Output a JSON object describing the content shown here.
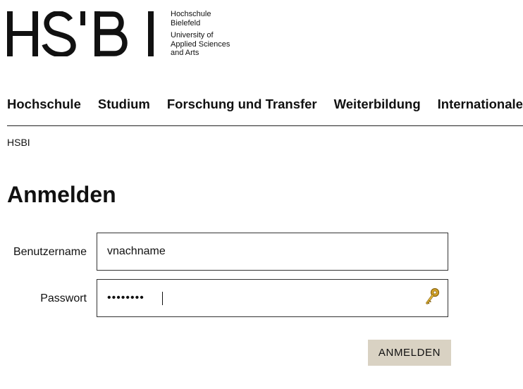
{
  "brand": {
    "logo_text": "HS'BI",
    "line1": "Hochschule",
    "line2": "Bielefeld",
    "line3": "University of",
    "line4": "Applied Sciences",
    "line5": "and Arts"
  },
  "nav": {
    "items": [
      "Hochschule",
      "Studium",
      "Forschung und Transfer",
      "Weiterbildung",
      "Internationales"
    ]
  },
  "breadcrumb": {
    "label": "HSBI"
  },
  "page": {
    "title": "Anmelden"
  },
  "form": {
    "username_label": "Benutzername",
    "username_value": "vnachname",
    "password_label": "Passwort",
    "password_value": "abcdefgh",
    "password_icon": "key-icon",
    "submit_label": "ANMELDEN"
  },
  "colors": {
    "accent_button": "#d9d2c3",
    "key_gold": "#d4a52a"
  }
}
